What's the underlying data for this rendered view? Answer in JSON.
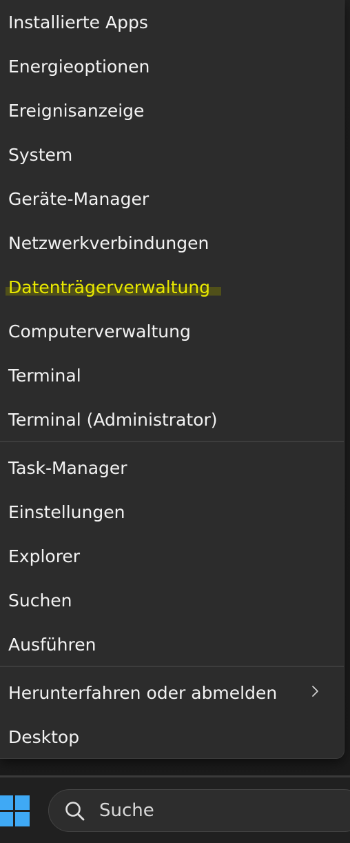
{
  "menu": {
    "items": [
      {
        "label": "Installierte Apps"
      },
      {
        "label": "Energieoptionen"
      },
      {
        "label": "Ereignisanzeige"
      },
      {
        "label": "System"
      },
      {
        "label": "Geräte-Manager"
      },
      {
        "label": "Netzwerkverbindungen"
      },
      {
        "label": "Datenträgerverwaltung",
        "highlighted": true
      },
      {
        "label": "Computerverwaltung"
      },
      {
        "label": "Terminal"
      },
      {
        "label": "Terminal (Administrator)"
      },
      {
        "label": "Task-Manager"
      },
      {
        "label": "Einstellungen"
      },
      {
        "label": "Explorer"
      },
      {
        "label": "Suchen"
      },
      {
        "label": "Ausführen"
      },
      {
        "label": "Herunterfahren oder abmelden",
        "submenu": true
      },
      {
        "label": "Desktop"
      }
    ]
  },
  "taskbar": {
    "search_placeholder": "Suche",
    "start_icon": "windows-logo-icon",
    "search_icon": "search-icon"
  },
  "colors": {
    "menu_background": "#2c2c2c",
    "text": "#f2f2f2",
    "highlight_text": "#e8e800",
    "separator": "#3d3d3d",
    "taskbar": "#202020",
    "start_blue": "#3fa9f5"
  }
}
